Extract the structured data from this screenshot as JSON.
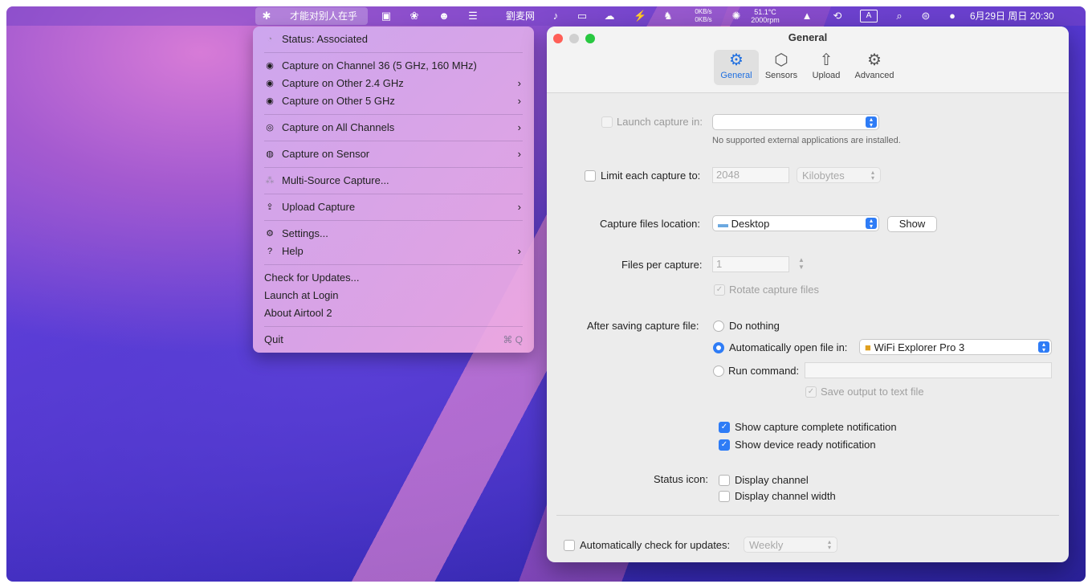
{
  "menubar": {
    "active_app_label": "才能对别人在乎",
    "text_app": "劉麦网",
    "net_up": "0KB/s",
    "net_down": "0KB/s",
    "temp": "51.1°C",
    "fan": "2000rpm",
    "input_method": "A",
    "datetime": "6月29日 周日  20:30"
  },
  "menu": {
    "status": "Status: Associated",
    "items": [
      {
        "label": "Capture on Channel 36 (5 GHz, 160 MHz)"
      },
      {
        "label": "Capture on Other 2.4 GHz"
      },
      {
        "label": "Capture on Other 5 GHz"
      },
      {
        "label": "Capture on All Channels"
      },
      {
        "label": "Capture on Sensor"
      },
      {
        "label": "Multi-Source Capture..."
      },
      {
        "label": "Upload Capture"
      },
      {
        "label": "Settings..."
      },
      {
        "label": "Help"
      },
      {
        "label": "Check for Updates..."
      },
      {
        "label": "Launch at Login"
      },
      {
        "label": "About Airtool 2"
      },
      {
        "label": "Quit"
      }
    ],
    "quit_shortcut": "⌘ Q"
  },
  "window": {
    "title": "General",
    "tabs": [
      {
        "label": "General"
      },
      {
        "label": "Sensors"
      },
      {
        "label": "Upload"
      },
      {
        "label": "Advanced"
      }
    ]
  },
  "settings": {
    "launch_label": "Launch capture in:",
    "launch_value": "",
    "launch_note": "No supported external applications are installed.",
    "limit_label": "Limit each capture to:",
    "limit_value": "2048",
    "limit_unit": "Kilobytes",
    "location_label": "Capture files location:",
    "location_value": "Desktop",
    "show_button": "Show",
    "files_per_label": "Files per capture:",
    "files_per_value": "1",
    "rotate_label": "Rotate capture files",
    "after_label": "After saving capture file:",
    "do_nothing": "Do nothing",
    "auto_open": "Automatically open file in:",
    "auto_open_app": "WiFi Explorer Pro 3",
    "run_command": "Run command:",
    "run_command_value": "",
    "save_output": "Save output to text file",
    "notif_complete": "Show capture complete notification",
    "notif_ready": "Show device ready notification",
    "status_icon_label": "Status icon:",
    "display_channel": "Display channel",
    "display_width": "Display channel width",
    "auto_updates_label": "Automatically check for updates:",
    "auto_updates_value": "Weekly"
  },
  "colors": {
    "accent": "#2e7cf6",
    "close": "#ff5f57",
    "minimize": "#d0d0d0",
    "zoom": "#28c840"
  }
}
